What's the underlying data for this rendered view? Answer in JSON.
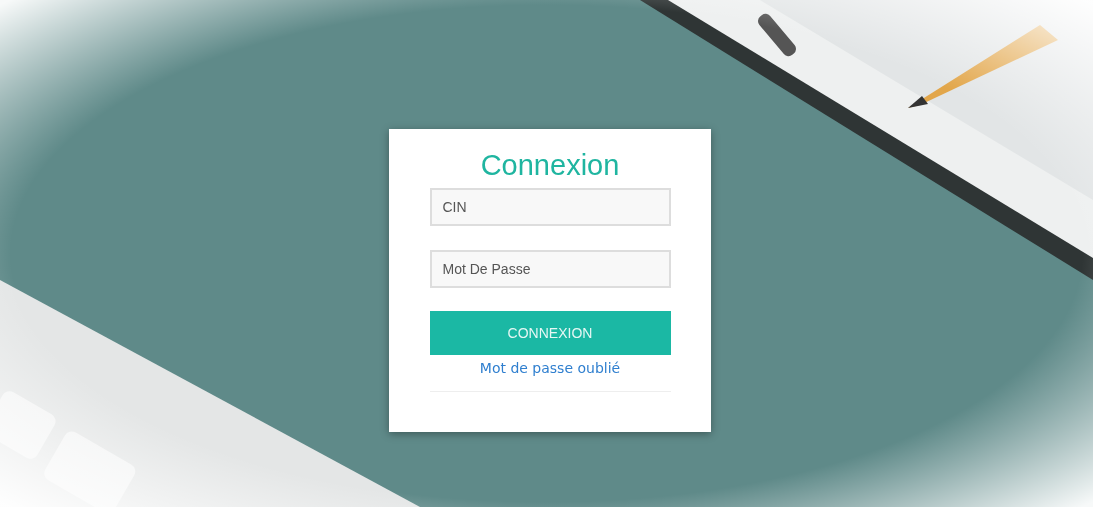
{
  "login": {
    "title": "Connexion",
    "fields": [
      {
        "placeholder": "CIN"
      },
      {
        "placeholder": "Mot De Passe"
      }
    ],
    "submit_button": "CONNEXION",
    "forgot_link": "Mot de passe oublié"
  }
}
